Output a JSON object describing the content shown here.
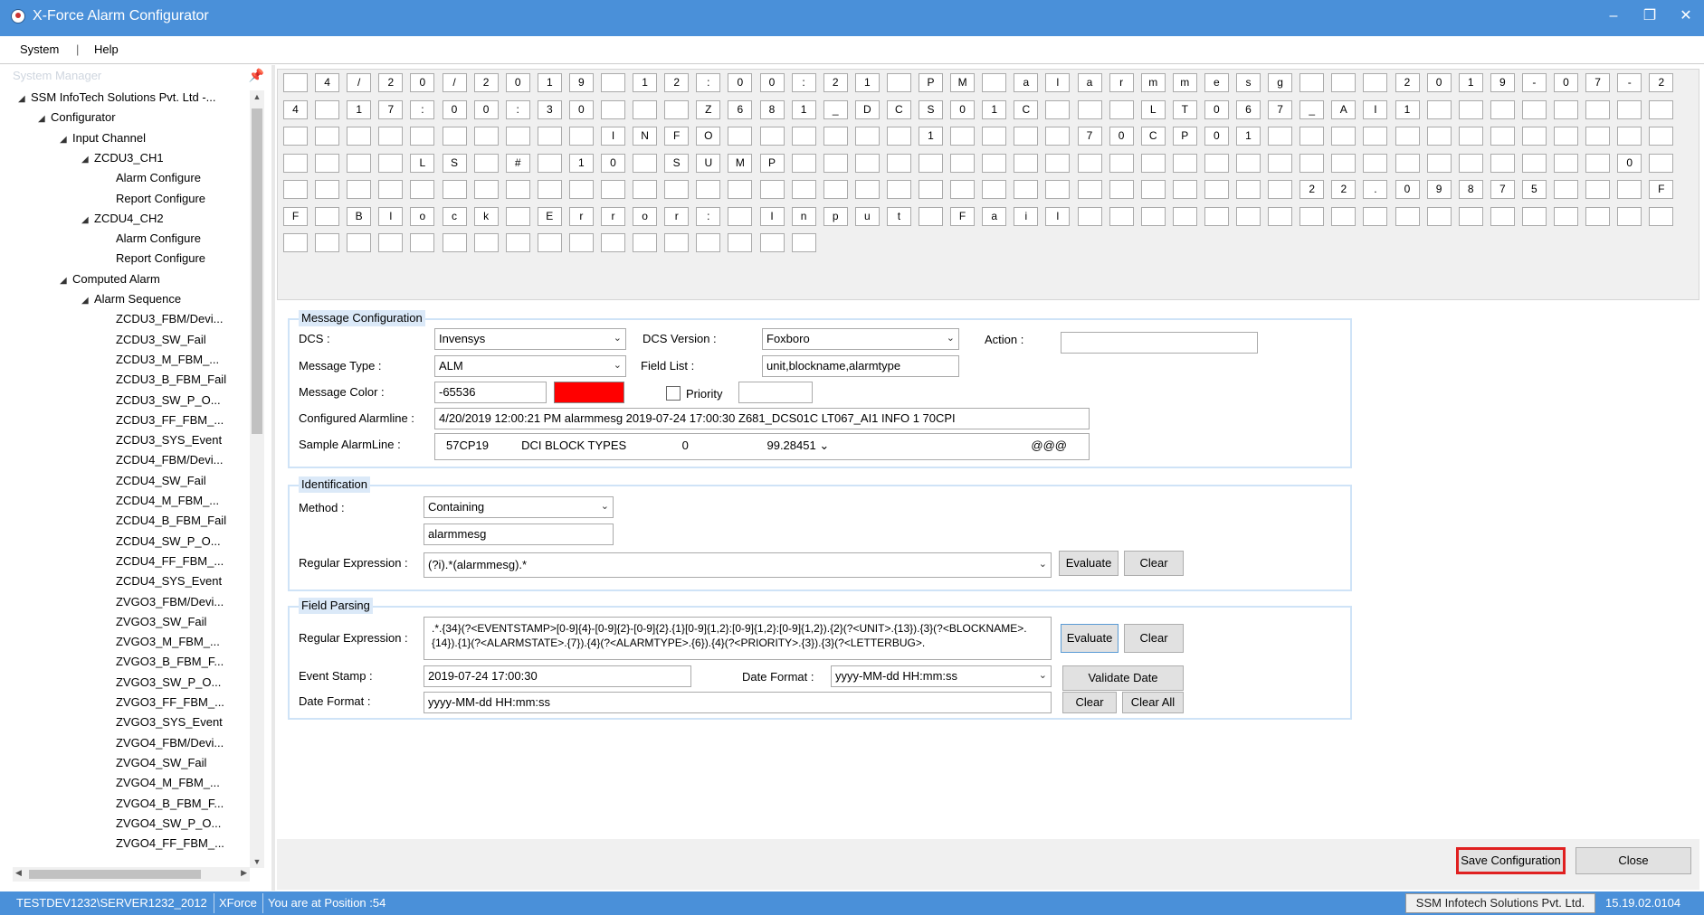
{
  "window": {
    "title": "X-Force Alarm Configurator",
    "minimize": "–",
    "restore": "❐",
    "close": "✕"
  },
  "menu": {
    "system": "System",
    "separator": "|",
    "help": "Help"
  },
  "sidebar": {
    "title": "System Manager",
    "tree": [
      {
        "label": "SSM InfoTech Solutions Pvt. Ltd -...",
        "toggle": "◢",
        "level": 0
      },
      {
        "label": "Configurator",
        "toggle": "◢",
        "level": 1
      },
      {
        "label": "Input Channel",
        "toggle": "◢",
        "level": 2
      },
      {
        "label": "ZCDU3_CH1",
        "toggle": "◢",
        "level": 3
      },
      {
        "label": "Alarm Configure",
        "toggle": "",
        "level": 4
      },
      {
        "label": "Report Configure",
        "toggle": "",
        "level": 4
      },
      {
        "label": "ZCDU4_CH2",
        "toggle": "◢",
        "level": 3
      },
      {
        "label": "Alarm Configure",
        "toggle": "",
        "level": 4
      },
      {
        "label": "Report Configure",
        "toggle": "",
        "level": 4
      },
      {
        "label": "Computed Alarm",
        "toggle": "◢",
        "level": 2
      },
      {
        "label": "Alarm Sequence",
        "toggle": "◢",
        "level": 3
      },
      {
        "label": "ZCDU3_FBM/Devi...",
        "toggle": "",
        "level": 4
      },
      {
        "label": "ZCDU3_SW_Fail",
        "toggle": "",
        "level": 4
      },
      {
        "label": "ZCDU3_M_FBM_...",
        "toggle": "",
        "level": 4
      },
      {
        "label": "ZCDU3_B_FBM_Fail",
        "toggle": "",
        "level": 4
      },
      {
        "label": "ZCDU3_SW_P_O...",
        "toggle": "",
        "level": 4
      },
      {
        "label": "ZCDU3_FF_FBM_...",
        "toggle": "",
        "level": 4
      },
      {
        "label": "ZCDU3_SYS_Event",
        "toggle": "",
        "level": 4
      },
      {
        "label": "ZCDU4_FBM/Devi...",
        "toggle": "",
        "level": 4
      },
      {
        "label": "ZCDU4_SW_Fail",
        "toggle": "",
        "level": 4
      },
      {
        "label": "ZCDU4_M_FBM_...",
        "toggle": "",
        "level": 4
      },
      {
        "label": "ZCDU4_B_FBM_Fail",
        "toggle": "",
        "level": 4
      },
      {
        "label": "ZCDU4_SW_P_O...",
        "toggle": "",
        "level": 4
      },
      {
        "label": "ZCDU4_FF_FBM_...",
        "toggle": "",
        "level": 4
      },
      {
        "label": "ZCDU4_SYS_Event",
        "toggle": "",
        "level": 4
      },
      {
        "label": "ZVGO3_FBM/Devi...",
        "toggle": "",
        "level": 4
      },
      {
        "label": "ZVGO3_SW_Fail",
        "toggle": "",
        "level": 4
      },
      {
        "label": "ZVGO3_M_FBM_...",
        "toggle": "",
        "level": 4
      },
      {
        "label": "ZVGO3_B_FBM_F...",
        "toggle": "",
        "level": 4
      },
      {
        "label": "ZVGO3_SW_P_O...",
        "toggle": "",
        "level": 4
      },
      {
        "label": "ZVGO3_FF_FBM_...",
        "toggle": "",
        "level": 4
      },
      {
        "label": "ZVGO3_SYS_Event",
        "toggle": "",
        "level": 4
      },
      {
        "label": "ZVGO4_FBM/Devi...",
        "toggle": "",
        "level": 4
      },
      {
        "label": "ZVGO4_SW_Fail",
        "toggle": "",
        "level": 4
      },
      {
        "label": "ZVGO4_M_FBM_...",
        "toggle": "",
        "level": 4
      },
      {
        "label": "ZVGO4_B_FBM_F...",
        "toggle": "",
        "level": 4
      },
      {
        "label": "ZVGO4_SW_P_O...",
        "toggle": "",
        "level": 4
      },
      {
        "label": "ZVGO4_FF_FBM_...",
        "toggle": "",
        "level": 4
      },
      {
        "label": "ZVGO4_SYS_Event",
        "toggle": "",
        "level": 4
      }
    ]
  },
  "char_grid": {
    "columns": 44,
    "rows": [
      [
        "",
        "4",
        "/",
        "2",
        "0",
        "/",
        "2",
        "0",
        "1",
        "9",
        "",
        "1",
        "2",
        ":",
        "0",
        "0",
        ":",
        "2",
        "1",
        "",
        "P",
        "M",
        "",
        "a",
        "l",
        "a",
        "r",
        "m",
        "m",
        "e",
        "s",
        "g",
        "",
        "",
        "",
        "2",
        "0",
        "1",
        "9",
        "-",
        "0",
        "7",
        "-",
        "2"
      ],
      [
        "4",
        "",
        "1",
        "7",
        ":",
        "0",
        "0",
        ":",
        "3",
        "0",
        "",
        "",
        "",
        "Z",
        "6",
        "8",
        "1",
        "_",
        "D",
        "C",
        "S",
        "0",
        "1",
        "C",
        "",
        "",
        "",
        "L",
        "T",
        "0",
        "6",
        "7",
        "_",
        "A",
        "I",
        "1",
        "",
        "",
        "",
        "",
        "",
        "",
        "",
        ""
      ],
      [
        "",
        "",
        "",
        "",
        "",
        "",
        "",
        "",
        "",
        "",
        "I",
        "N",
        "F",
        "O",
        "",
        "",
        "",
        "",
        "",
        "",
        "1",
        "",
        "",
        "",
        "",
        "7",
        "0",
        "C",
        "P",
        "0",
        "1",
        "",
        "",
        "",
        "",
        "",
        "",
        "",
        "",
        "",
        "",
        "",
        "",
        ""
      ],
      [
        "",
        "",
        "",
        "",
        "L",
        "S",
        "",
        "#",
        "",
        "1",
        "0",
        "",
        "S",
        "U",
        "M",
        "P",
        "",
        "",
        "",
        "",
        "",
        "",
        "",
        "",
        "",
        "",
        "",
        "",
        "",
        "",
        "",
        "",
        "",
        "",
        "",
        "",
        "",
        "",
        "",
        "",
        "",
        "",
        "0",
        ""
      ],
      [
        "",
        "",
        "",
        "",
        "",
        "",
        "",
        "",
        "",
        "",
        "",
        "",
        "",
        "",
        "",
        "",
        "",
        "",
        "",
        "",
        "",
        "",
        "",
        "",
        "",
        "",
        "",
        "",
        "",
        "",
        "",
        "",
        "2",
        "2",
        ".",
        "0",
        "9",
        "8",
        "7",
        "5",
        "",
        "",
        "",
        "F"
      ],
      [
        "F",
        "",
        "B",
        "l",
        "o",
        "c",
        "k",
        "",
        "E",
        "r",
        "r",
        "o",
        "r",
        ":",
        "",
        "I",
        "n",
        "p",
        "u",
        "t",
        "",
        "F",
        "a",
        "i",
        "l",
        "",
        "",
        "",
        "",
        "",
        "",
        "",
        "",
        "",
        "",
        "",
        "",
        "",
        "",
        "",
        "",
        "",
        "",
        ""
      ],
      [
        "",
        "",
        "",
        "",
        "",
        "",
        "",
        "",
        "",
        "",
        "",
        "",
        "",
        "",
        "",
        "",
        ""
      ]
    ]
  },
  "message_config": {
    "title": "Message Configuration",
    "dcs_label": "DCS :",
    "dcs_value": "Invensys",
    "dcs_version_label": "DCS Version :",
    "dcs_version_value": "Foxboro",
    "action_label": "Action :",
    "action_value": "",
    "message_type_label": "Message Type :",
    "message_type_value": "ALM",
    "field_list_label": "Field List :",
    "field_list_value": "unit,blockname,alarmtype",
    "message_color_label": "Message Color :",
    "message_color_value": "-65536",
    "message_color_swatch": "#ff0000",
    "priority_label": "Priority",
    "priority_checked": false,
    "priority_value": "",
    "configured_label": "Configured Alarmline :",
    "configured_value": "4/20/2019 12:00:21 PM alarmmesg   2019-07-24 17:00:30   Z681_DCS01C   LT067_AI1           INFO     1    70CPI",
    "sample_label": "Sample AlarmLine :",
    "sample_value": "57CP19          DCI BLOCK TYPES                 0                        99.28451",
    "sample_suffix": "@@@"
  },
  "identification": {
    "title": "Identification",
    "method_label": "Method :",
    "method_value": "Containing",
    "pattern_value": "alarmmesg",
    "regex_label": "Regular Expression :",
    "regex_value": "(?i).*(alarmmesg).*",
    "evaluate": "Evaluate",
    "clear": "Clear"
  },
  "field_parsing": {
    "title": "Field Parsing",
    "regex_label": "Regular Expression :",
    "regex_value": ".*.{34}(?<EVENTSTAMP>[0-9]{4}-[0-9]{2}-[0-9]{2}.{1}[0-9]{1,2}:[0-9]{1,2}:[0-9]{1,2}).{2}(?<UNIT>.{13}).{3}(?<BLOCKNAME>.{14}).{1}(?<ALARMSTATE>.{7}).{4}(?<ALARMTYPE>.{6}).{4}(?<PRIORITY>.{3}).{3}(?<LETTERBUG>.",
    "evaluate": "Evaluate",
    "clear": "Clear",
    "event_stamp_label": "Event Stamp :",
    "event_stamp_value": "2019-07-24 17:00:30",
    "date_format_label": "Date Format :",
    "date_format_combo": "yyyy-MM-dd HH:mm:ss",
    "validate_date": "Validate Date",
    "date_format2_label": "Date Format :",
    "date_format2_value": "yyyy-MM-dd HH:mm:ss",
    "clear2": "Clear",
    "clear_all": "Clear All"
  },
  "footer": {
    "save": "Save Configuration",
    "close": "Close"
  },
  "status": {
    "server": "TESTDEV1232\\SERVER1232_2012",
    "app": "XForce",
    "position": "You are at Position :54",
    "company": "SSM Infotech Solutions Pvt. Ltd.",
    "version": "15.19.02.0104"
  }
}
